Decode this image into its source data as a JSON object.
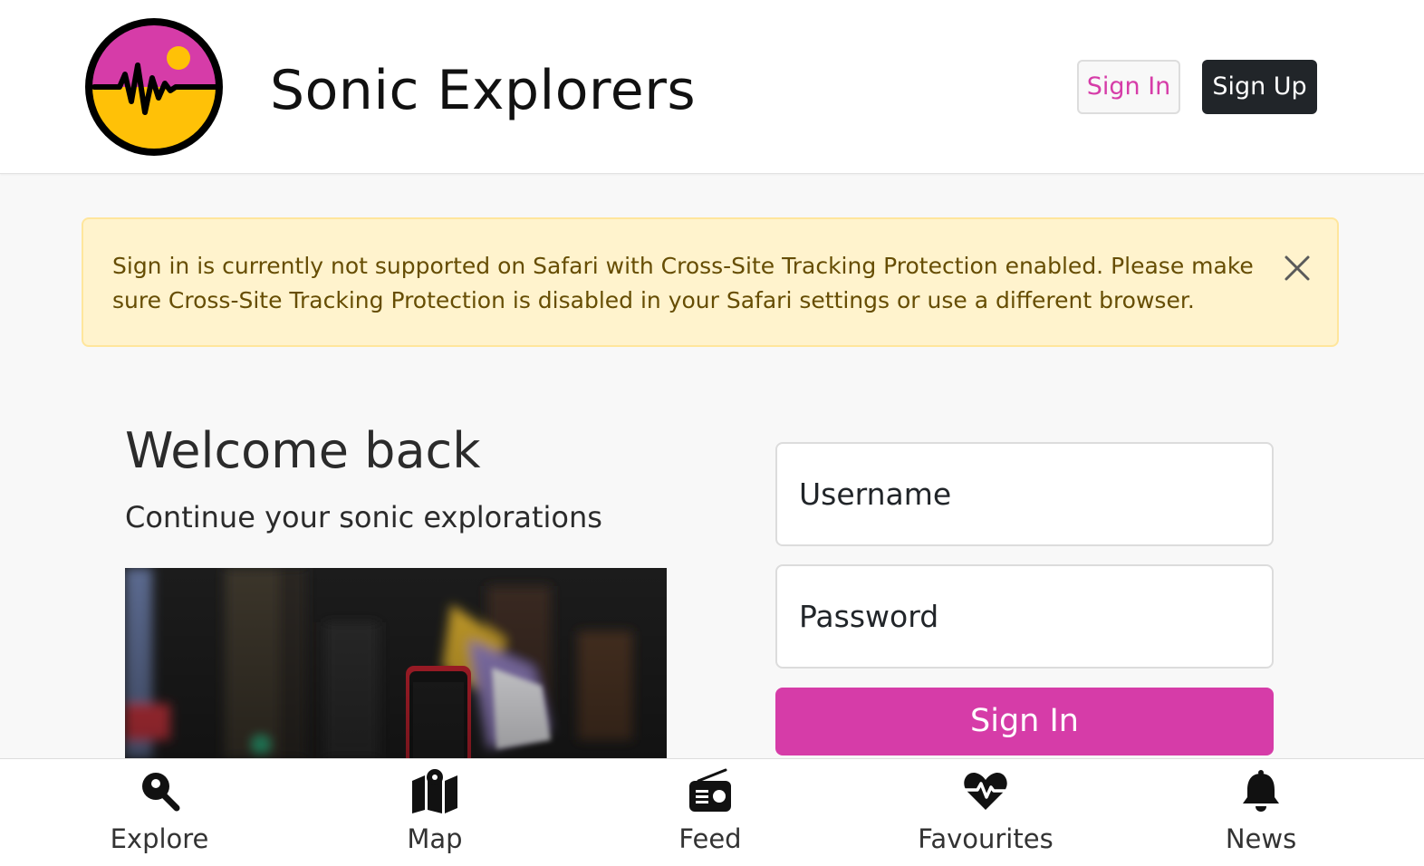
{
  "header": {
    "brand": "Sonic Explorers",
    "sign_in_label": "Sign In",
    "sign_up_label": "Sign Up"
  },
  "alert": {
    "message": "Sign in is currently not supported on Safari with Cross-Site Tracking Protection enabled. Please make sure Cross-Site Tracking Protection is disabled in your Safari settings or use a different browser."
  },
  "welcome": {
    "title": "Welcome back",
    "subtitle": "Continue your sonic explorations"
  },
  "form": {
    "username_placeholder": "Username",
    "password_placeholder": "Password",
    "submit_label": "Sign In"
  },
  "bottom_nav": {
    "items": [
      {
        "label": "Explore",
        "icon": "map-pin-search-icon"
      },
      {
        "label": "Map",
        "icon": "map-icon"
      },
      {
        "label": "Feed",
        "icon": "radio-icon"
      },
      {
        "label": "Favourites",
        "icon": "heart-pulse-icon"
      },
      {
        "label": "News",
        "icon": "bell-icon"
      }
    ]
  },
  "colors": {
    "accent": "#d63ca8",
    "dark_button": "#212529",
    "alert_bg": "#fff3cd",
    "alert_border": "#ffe69c",
    "alert_text": "#664d03",
    "logo_top": "#d63ca8",
    "logo_bottom": "#ffc107"
  }
}
